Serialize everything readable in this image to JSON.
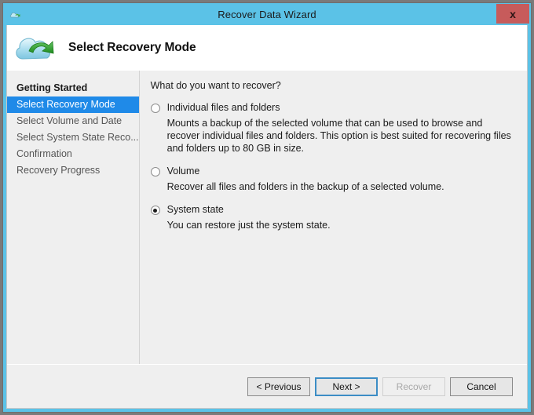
{
  "window": {
    "title": "Recover Data Wizard",
    "title_icon": "cloud-icon",
    "close_label": "x",
    "frame_color": "#5bc2e7",
    "close_button_color": "#c75b5b"
  },
  "header": {
    "title": "Select Recovery Mode",
    "icon": "cloud-recover-icon"
  },
  "sidebar": {
    "items": [
      {
        "label": "Getting Started",
        "state": "done"
      },
      {
        "label": "Select Recovery Mode",
        "state": "current"
      },
      {
        "label": "Select Volume and Date",
        "state": "pending"
      },
      {
        "label": "Select System State Reco...",
        "state": "pending"
      },
      {
        "label": "Confirmation",
        "state": "pending"
      },
      {
        "label": "Recovery Progress",
        "state": "pending"
      }
    ],
    "highlight_color": "#1f8ae8"
  },
  "content": {
    "question": "What do you want to recover?",
    "options": [
      {
        "label": "Individual files and folders",
        "description": "Mounts a backup of the selected volume that can be used to browse and recover individual files and folders. This option is best suited for recovering files and folders up to 80 GB in size.",
        "selected": false
      },
      {
        "label": "Volume",
        "description": "Recover all files and folders in the backup of a selected volume.",
        "selected": false
      },
      {
        "label": "System state",
        "description": "You can restore just the system state.",
        "selected": true
      }
    ]
  },
  "footer": {
    "buttons": [
      {
        "label": "< Previous",
        "state": "normal"
      },
      {
        "label": "Next >",
        "state": "focused"
      },
      {
        "label": "Recover",
        "state": "disabled"
      },
      {
        "label": "Cancel",
        "state": "normal"
      }
    ]
  }
}
